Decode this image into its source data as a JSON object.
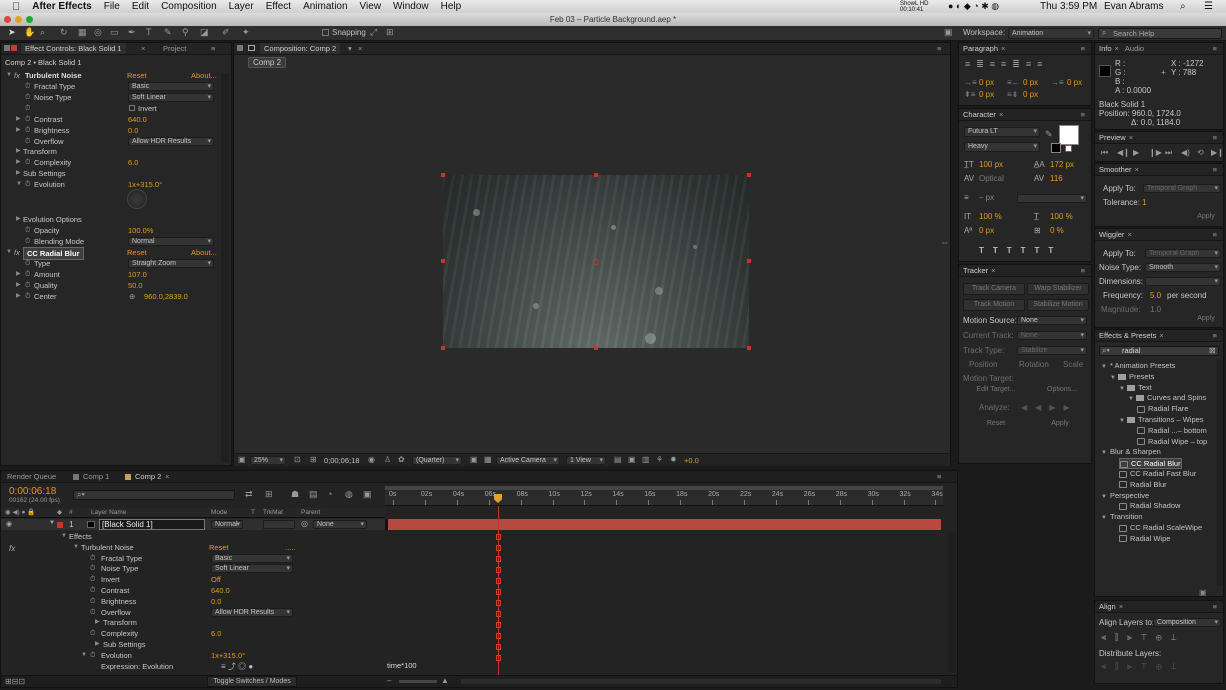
{
  "menubar": {
    "apple": "",
    "app": "After Effects",
    "items": [
      "File",
      "Edit",
      "Composition",
      "Layer",
      "Effect",
      "Animation",
      "View",
      "Window",
      "Help"
    ],
    "extras": "ShowL HD 00:10:41",
    "time": "Thu 3:59 PM",
    "user": "Evan Abrams"
  },
  "window": {
    "title": "Feb 03 – Particle Background.aep *"
  },
  "toolbar": {
    "snapping": "Snapping",
    "workspace_label": "Workspace:",
    "workspace": "Animation",
    "search": "Search Help"
  },
  "effects_panel": {
    "tab": "Effect Controls: Black Solid 1",
    "tab2": "Project",
    "subject": "Comp 2 • Black Solid 1",
    "fx1": {
      "name": "Turbulent Noise",
      "reset": "Reset",
      "about": "About..."
    },
    "rows": [
      {
        "label": "Fractal Type",
        "type": "dd",
        "value": "Basic"
      },
      {
        "label": "Noise Type",
        "type": "dd",
        "value": "Soft Linear"
      },
      {
        "label": "",
        "type": "check",
        "value": "Invert"
      },
      {
        "label": "Contrast",
        "type": "val",
        "value": "640.0"
      },
      {
        "label": "Brightness",
        "type": "val",
        "value": "0.0"
      },
      {
        "label": "Overflow",
        "type": "dd",
        "value": "Allow HDR Results"
      },
      {
        "label": "Transform",
        "type": "group",
        "value": ""
      },
      {
        "label": "Complexity",
        "type": "val",
        "value": "6.0"
      },
      {
        "label": "Sub Settings",
        "type": "group",
        "value": ""
      },
      {
        "label": "Evolution",
        "type": "val",
        "value": "1x+315.0°"
      }
    ],
    "rows2": [
      {
        "label": "Evolution Options",
        "type": "group",
        "value": ""
      },
      {
        "label": "Opacity",
        "type": "val",
        "value": "100.0%"
      },
      {
        "label": "Blending Mode",
        "type": "dd",
        "value": "Normal"
      }
    ],
    "fx2": {
      "name": "CC Radial Blur",
      "reset": "Reset",
      "about": "About..."
    },
    "rows3": [
      {
        "label": "Type",
        "type": "dd",
        "value": "Straight Zoom"
      },
      {
        "label": "Amount",
        "type": "val",
        "value": "107.0"
      },
      {
        "label": "Quality",
        "type": "val",
        "value": "50.0"
      },
      {
        "label": "Center",
        "type": "val",
        "value": "960.0,2839.0"
      }
    ]
  },
  "comp": {
    "tab": "Composition: Comp 2",
    "subtab": "Comp 2",
    "zoom": "25%",
    "timecode": "0;00;06;18",
    "quality": "(Quarter)",
    "camera": "Active Camera",
    "view": "1 View",
    "exposure": "+0.0"
  },
  "paragraph": {
    "tab": "Paragraph",
    "fields": [
      "0 px",
      "0 px",
      "0 px",
      "0 px",
      "0 px"
    ]
  },
  "character": {
    "tab": "Character",
    "font": "Futura LT",
    "style": "Heavy",
    "size": "100 px",
    "leading": "172 px",
    "kerning": "Optical",
    "tracking": "116",
    "stroke": "– px",
    "vscale": "100 %",
    "hscale": "100 %",
    "baseline": "0 px",
    "tsume": "0 %"
  },
  "tracker": {
    "tab": "Tracker",
    "btns": [
      "Track Camera",
      "Warp Stabilizer",
      "Track Motion",
      "Stabilize Motion"
    ],
    "motion_source_label": "Motion Source:",
    "motion_source": "None",
    "current_track_label": "Current Track:",
    "current_track": "None",
    "track_type_label": "Track Type:",
    "track_type": "Stabilize",
    "checks": [
      "Position",
      "Rotation",
      "Scale"
    ],
    "motion_target": "Motion Target:",
    "edit_target": "Edit Target...",
    "options": "Options...",
    "analyze": "Analyze:",
    "reset": "Reset",
    "apply": "Apply"
  },
  "info": {
    "tab": "Info",
    "tab2": "Audio",
    "r": "R :",
    "g": "G :",
    "b": "B :",
    "a": "A : 0.0000",
    "x": "X : -1272",
    "y": "Y : 788",
    "layer": "Black Solid 1",
    "position": "Position: 960.0, 1724.0",
    "delta": "Δ: 0.0, 1184.0"
  },
  "preview": {
    "tab": "Preview"
  },
  "smoother": {
    "tab": "Smoother",
    "apply_to_label": "Apply To:",
    "apply_to": "Temporal Graph",
    "tolerance_label": "Tolerance:",
    "tolerance": "1",
    "apply": "Apply"
  },
  "wiggler": {
    "tab": "Wiggler",
    "apply_to_label": "Apply To:",
    "apply_to": "Temporal Graph",
    "noise_label": "Noise Type:",
    "noise": "Smooth",
    "dimensions": "Dimensions:",
    "frequency_label": "Frequency:",
    "frequency": "5.0",
    "per_second": "per second",
    "magnitude_label": "Magnitude:",
    "magnitude": "1.0",
    "apply": "Apply"
  },
  "effects_presets": {
    "tab": "Effects & Presets",
    "search": "radial",
    "tree": [
      {
        "indent": 0,
        "kind": "tri",
        "text": "* Animation Presets"
      },
      {
        "indent": 1,
        "kind": "folder",
        "text": "Presets"
      },
      {
        "indent": 2,
        "kind": "folder",
        "text": "Text"
      },
      {
        "indent": 3,
        "kind": "folder",
        "text": "Curves and Spins"
      },
      {
        "indent": 4,
        "kind": "fx",
        "text": "Radial Flare"
      },
      {
        "indent": 2,
        "kind": "folder",
        "text": "Transitions – Wipes"
      },
      {
        "indent": 4,
        "kind": "fx",
        "text": "Radial ...– bottom"
      },
      {
        "indent": 4,
        "kind": "fx",
        "text": "Radial Wipe – top"
      },
      {
        "indent": 0,
        "kind": "tri",
        "text": "Blur & Sharpen"
      },
      {
        "indent": 2,
        "kind": "fx",
        "text": "CC Radial Blur",
        "selected": true
      },
      {
        "indent": 2,
        "kind": "fx",
        "text": "CC Radial Fast Blur"
      },
      {
        "indent": 2,
        "kind": "fx",
        "text": "Radial Blur"
      },
      {
        "indent": 0,
        "kind": "tri",
        "text": "Perspective"
      },
      {
        "indent": 2,
        "kind": "fx",
        "text": "Radial Shadow"
      },
      {
        "indent": 0,
        "kind": "tri",
        "text": "Transition"
      },
      {
        "indent": 2,
        "kind": "fx",
        "text": "CC Radial ScaleWipe"
      },
      {
        "indent": 2,
        "kind": "fx",
        "text": "Radial Wipe"
      }
    ]
  },
  "align": {
    "tab": "Align",
    "align_to_label": "Align Layers to:",
    "align_to": "Composition",
    "distribute": "Distribute Layers:"
  },
  "timeline": {
    "tabs": [
      "Render Queue",
      "Comp 1",
      "Comp 2"
    ],
    "timecode": "0:00:06:18",
    "frames": "00162 (24.00 fps)",
    "ticks": [
      "0s",
      "02s",
      "04s",
      "06s",
      "08s",
      "10s",
      "12s",
      "14s",
      "16s",
      "18s",
      "20s",
      "22s",
      "24s",
      "26s",
      "28s",
      "30s",
      "32s",
      "34s"
    ],
    "cols": {
      "num": "#",
      "layer": "Layer Name",
      "mode": "Mode",
      "t": "T",
      "trkmat": "TrkMat",
      "parent": "Parent"
    },
    "layer": {
      "num": "1",
      "name": "[Black Solid 1]",
      "mode": "Normal",
      "parent": "None"
    },
    "props": [
      {
        "indent": 0,
        "label": "Effects",
        "type": "tri",
        "value": ""
      },
      {
        "indent": 1,
        "label": "Turbulent Noise",
        "type": "fx",
        "value": "Reset"
      },
      {
        "indent": 2,
        "label": "Fractal Type",
        "type": "dd",
        "value": "Basic"
      },
      {
        "indent": 2,
        "label": "Noise Type",
        "type": "dd",
        "value": "Soft Linear"
      },
      {
        "indent": 2,
        "label": "Invert",
        "type": "val",
        "value": "Off"
      },
      {
        "indent": 2,
        "label": "Contrast",
        "type": "val",
        "value": "640.0"
      },
      {
        "indent": 2,
        "label": "Brightness",
        "type": "val",
        "value": "0.0"
      },
      {
        "indent": 2,
        "label": "Overflow",
        "type": "dd",
        "value": "Allow HDR Results"
      },
      {
        "indent": 1,
        "label": "Transform",
        "type": "tri",
        "value": ""
      },
      {
        "indent": 2,
        "label": "Complexity",
        "type": "val",
        "value": "6.0"
      },
      {
        "indent": 1,
        "label": "Sub Settings",
        "type": "tri",
        "value": ""
      },
      {
        "indent": 1,
        "label": "Evolution",
        "type": "val",
        "value": "1x+315.0°"
      },
      {
        "indent": 2,
        "label": "Expression: Evolution",
        "type": "expr",
        "value": ""
      }
    ],
    "expression": "time*100",
    "toggle": "Toggle Switches / Modes"
  }
}
